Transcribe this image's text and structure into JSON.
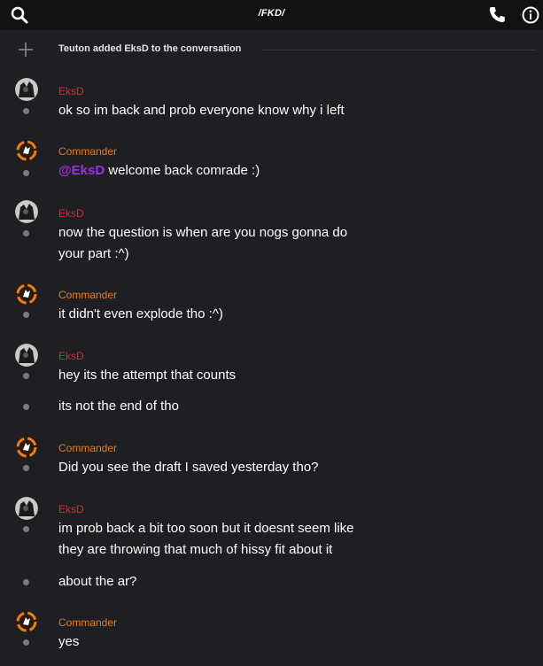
{
  "header": {
    "title": "/FKD/"
  },
  "system": {
    "actor": "Teuton",
    "text": "Teuton added EksD to the conversation"
  },
  "messages": [
    {
      "author": "EksD",
      "lines": [
        "ok so im back and prob everyone know why i left"
      ]
    },
    {
      "author": "Commander",
      "mention": "@EksD",
      "lines": [
        " welcome back comrade :)"
      ]
    },
    {
      "author": "EksD",
      "lines": [
        "now the question is when are you nogs gonna do",
        "your part :^)"
      ]
    },
    {
      "author": "Commander",
      "lines": [
        "it didn't even explode tho :^)"
      ]
    },
    {
      "author": "EksD",
      "lines": [
        "hey its the attempt that counts",
        "its not the end of tho"
      ]
    },
    {
      "author": "Commander",
      "lines": [
        "Did you see the draft I saved yesterday tho?"
      ]
    },
    {
      "author": "EksD",
      "lines": [
        "im prob back a bit too soon but it doesnt seem like",
        "they are throwing that much of hissy fit about it",
        "about the ar?"
      ]
    },
    {
      "author": "Commander",
      "lines": [
        "yes"
      ]
    }
  ],
  "colors": {
    "eksd": "#e0252e",
    "commander": "#e67e22",
    "mention": "#a02fe0",
    "background": "#1e1f22",
    "topbar": "#111214"
  },
  "icons": {
    "search": "search-icon",
    "phone": "phone-icon",
    "info": "info-icon",
    "add": "plus-icon"
  }
}
